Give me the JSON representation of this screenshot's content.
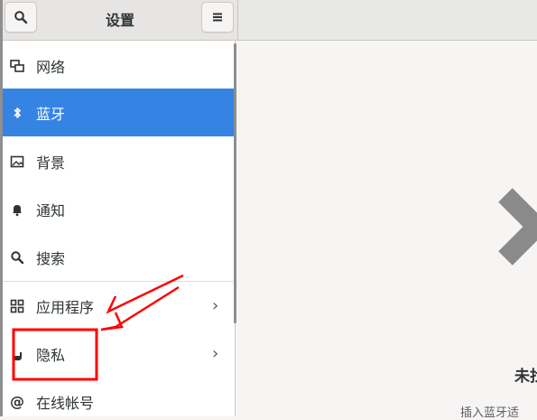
{
  "header": {
    "title": "设置",
    "search_icon": "search-icon",
    "menu_icon": "hamburger-menu-icon"
  },
  "sidebar": {
    "items": [
      {
        "label": "网络",
        "icon": "network-icon",
        "selected": false,
        "has_chevron": false
      },
      {
        "label": "蓝牙",
        "icon": "bluetooth-icon",
        "selected": true,
        "has_chevron": false
      },
      {
        "label": "背景",
        "icon": "background-icon",
        "selected": false,
        "has_chevron": false
      },
      {
        "label": "通知",
        "icon": "bell-icon",
        "selected": false,
        "has_chevron": false
      },
      {
        "label": "搜索",
        "icon": "search-icon",
        "selected": false,
        "has_chevron": false
      },
      {
        "label": "应用程序",
        "icon": "apps-grid-icon",
        "selected": false,
        "has_chevron": true
      },
      {
        "label": "隐私",
        "icon": "hand-icon",
        "selected": false,
        "has_chevron": true
      },
      {
        "label": "在线帐号",
        "icon": "at-icon",
        "selected": false,
        "has_chevron": false
      }
    ]
  },
  "content": {
    "status_title": "未找",
    "status_desc": "插入蓝牙适"
  },
  "colors": {
    "accent": "#3584e4",
    "annotation": "#ff0000"
  }
}
